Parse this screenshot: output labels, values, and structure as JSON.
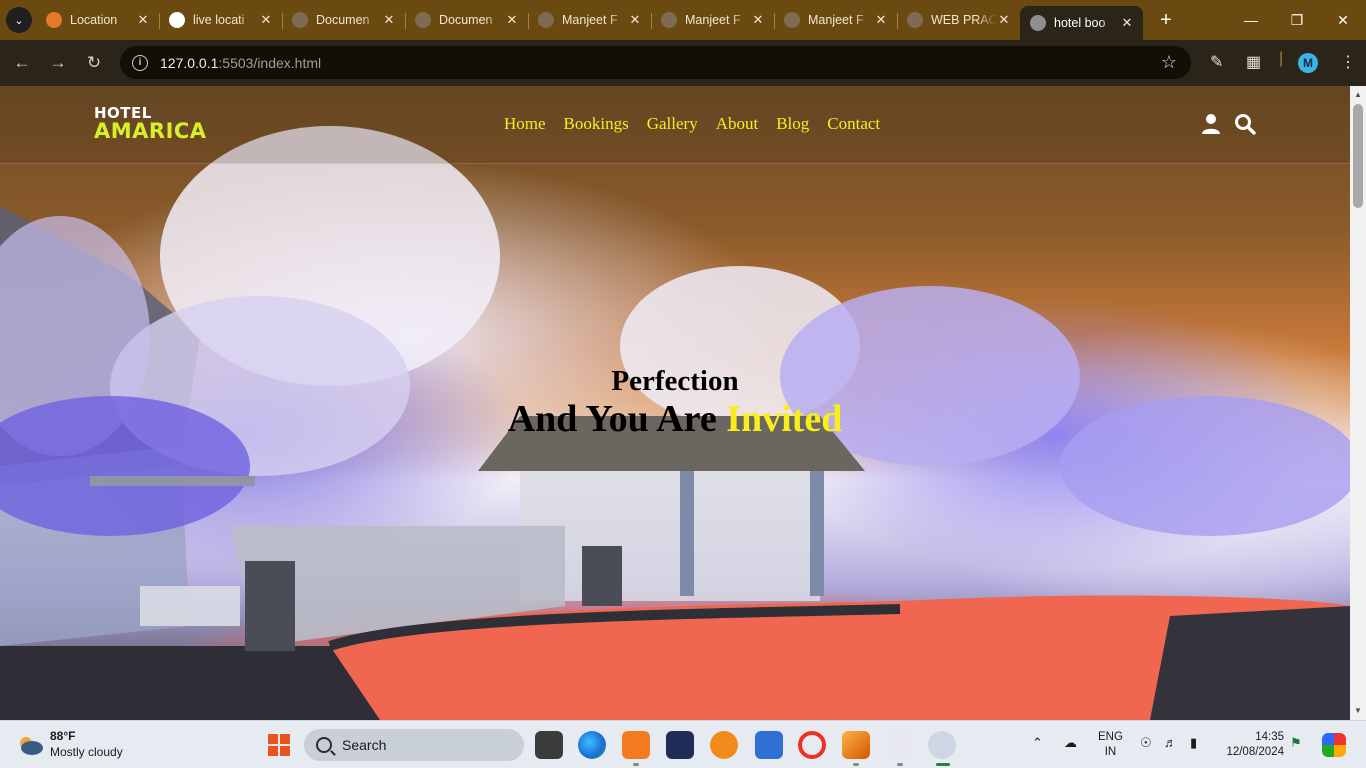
{
  "browser": {
    "tabs": [
      {
        "label": "Location",
        "fav": "#e37a2a"
      },
      {
        "label": "live locati",
        "fav": "#ffffff"
      },
      {
        "label": "Documen",
        "fav": "#7d6b52"
      },
      {
        "label": "Documen",
        "fav": "#7d6b52"
      },
      {
        "label": "Manjeet F",
        "fav": "#7d6b52"
      },
      {
        "label": "Manjeet F",
        "fav": "#7d6b52"
      },
      {
        "label": "Manjeet F",
        "fav": "#7d6b52"
      },
      {
        "label": "WEB PRAC",
        "fav": "#7d6b52"
      },
      {
        "label": "hotel boo",
        "fav": "#8e8e8e",
        "active": true
      }
    ],
    "url_host": "127.0.0.1",
    "url_path": ":5503/index.html",
    "profile_initial": "M"
  },
  "site": {
    "logo_line1": "HOTEL",
    "logo_line2": "AMARICA",
    "menu": [
      "Home",
      "Bookings",
      "Gallery",
      "About",
      "Blog",
      "Contact"
    ],
    "hero_line1": "Perfection",
    "hero_line2_plain": "And You Are ",
    "hero_line2_highlight": "Invited",
    "accent_color": "#f4ef22"
  },
  "taskbar": {
    "weather_temp": "88°F",
    "weather_desc": "Mostly cloudy",
    "search_label": "Search",
    "lang_line1": "ENG",
    "lang_line2": "IN",
    "time": "14:35",
    "date": "12/08/2024"
  }
}
